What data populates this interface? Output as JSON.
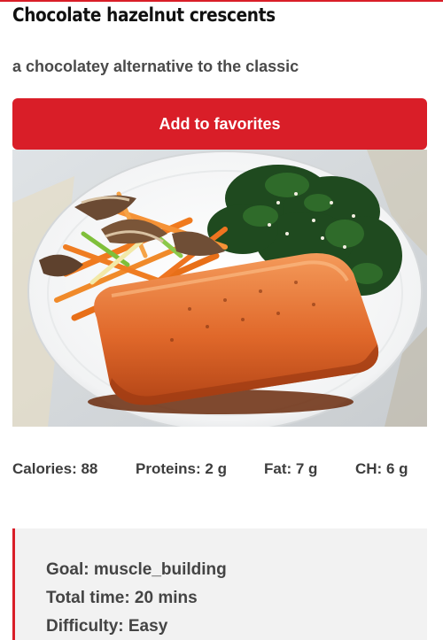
{
  "recipe": {
    "title": "Chocolate hazelnut crescents",
    "subtitle": "a chocolatey alternative to the classic",
    "favorite_label": "Add to favorites",
    "image_alt": "glazed salmon fillet with vegetables and spinach"
  },
  "nutrition": {
    "calories": "Calories: 88",
    "proteins": "Proteins: 2 g",
    "fat": "Fat: 7 g",
    "ch": "CH: 6 g"
  },
  "details": {
    "goal": "Goal: muscle_building",
    "total_time": "Total time: 20 mins",
    "difficulty": "Difficulty: Easy"
  },
  "colors": {
    "accent": "#d91e28",
    "info_background": "#f2f2f2",
    "text": "#3a3a3a"
  }
}
